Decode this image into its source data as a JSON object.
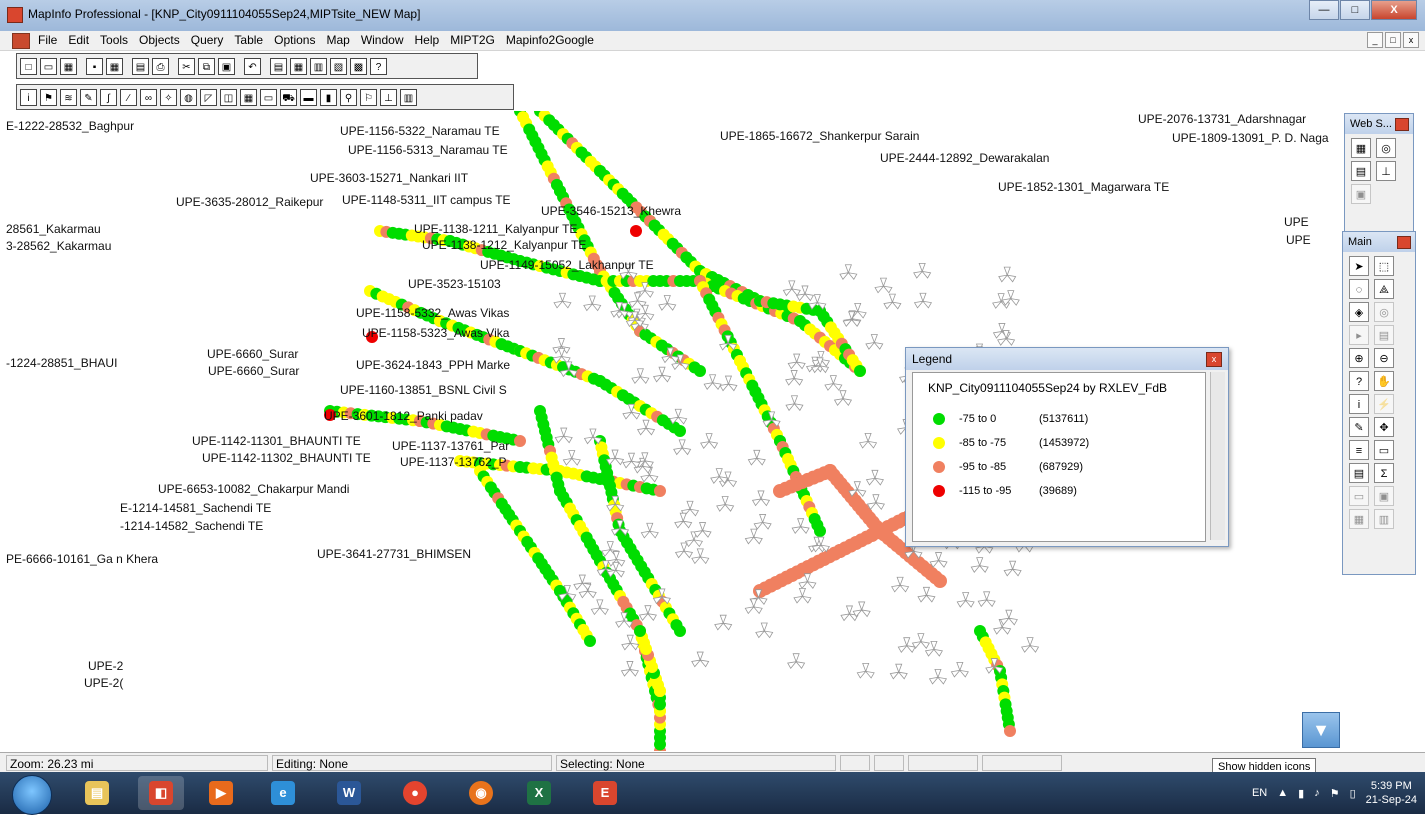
{
  "window": {
    "title": "MapInfo Professional - [KNP_City0911104055Sep24,MIPTsite_NEW Map]",
    "min": "—",
    "max": "□",
    "close": "X"
  },
  "menu": {
    "items": [
      "File",
      "Edit",
      "Tools",
      "Objects",
      "Query",
      "Table",
      "Options",
      "Map",
      "Window",
      "Help",
      "MIPT2G",
      "Mapinfo2Google"
    ],
    "mdi": [
      "_",
      "□",
      "x"
    ]
  },
  "map_labels": [
    {
      "text": "E-1222-28532_Baghpur"
    },
    {
      "text": "UPE-1156-5322_Naramau TE"
    },
    {
      "text": "UPE-1156-5313_Naramau TE"
    },
    {
      "text": "UPE-3603-15271_Nankari IIT"
    },
    {
      "text": "UPE-3635-28012_Raikepur"
    },
    {
      "text": "UPE-1148-5311_IIT campus TE"
    },
    {
      "text": "UPE-3546-15213_Khewra"
    },
    {
      "text": "28561_Kakarmau"
    },
    {
      "text": "3-28562_Kakarmau"
    },
    {
      "text": "UPE-1138-1211_Kalyanpur TE"
    },
    {
      "text": "UPE-1138-1212_Kalyanpur TE"
    },
    {
      "text": "UPE-1149-15052_Lakhanpur TE"
    },
    {
      "text": "UPE-3523-15103"
    },
    {
      "text": "UPE-1158-5332_Awas Vikas"
    },
    {
      "text": "UPE-1158-5323_Awas Vika"
    },
    {
      "text": "-1224-28851_BHAUI"
    },
    {
      "text": "UPE-6660_Surar"
    },
    {
      "text": "UPE-6660_Surar"
    },
    {
      "text": "UPE-3624-1843_PPH Marke"
    },
    {
      "text": "UPE-1160-13851_BSNL Civil S"
    },
    {
      "text": "UPE-3601-1812_Panki padav"
    },
    {
      "text": "UPE-1142-11301_BHAUNTI TE"
    },
    {
      "text": "UPE-1142-11302_BHAUNTI TE"
    },
    {
      "text": "UPE-1137-13761_Par"
    },
    {
      "text": "UPE-1137-13762_P"
    },
    {
      "text": "UPE-6653-10082_Chakarpur Mandi"
    },
    {
      "text": "E-1214-14581_Sachendi TE"
    },
    {
      "text": "-1214-14582_Sachendi TE"
    },
    {
      "text": "PE-6666-10161_Ga n Khera"
    },
    {
      "text": "UPE-3641-27731_BHIMSEN"
    },
    {
      "text": "UPE-1865-16672_Shankerpur Sarain"
    },
    {
      "text": "UPE-2444-12892_Dewarakalan"
    },
    {
      "text": "UPE-1852-1301_Magarwara TE"
    },
    {
      "text": "UPE-2076-13731_Adarshnagar"
    },
    {
      "text": "UPE-1809-13091_P. D. Naga"
    },
    {
      "text": "UPE"
    },
    {
      "text": "UPE"
    },
    {
      "text": "UPE-2"
    },
    {
      "text": "UPE-2("
    }
  ],
  "legend": {
    "window_title": "Legend",
    "heading": "KNP_City0911104055Sep24 by RXLEV_FdB",
    "rows": [
      {
        "range": "-75 to  0",
        "count": "(5137611)",
        "color": "#00dd00"
      },
      {
        "range": "-85 to -75",
        "count": "(1453972)",
        "color": "#ffff00"
      },
      {
        "range": "-95 to -85",
        "count": "(687929)",
        "color": "#f08060"
      },
      {
        "range": "-115 to -95",
        "count": "(39689)",
        "color": "#ee0000"
      }
    ]
  },
  "palettes": {
    "web": {
      "title": "Web S..."
    },
    "main": {
      "title": "Main"
    }
  },
  "status": {
    "zoom": "Zoom: 26.23 mi",
    "editing": "Editing: None",
    "selecting": "Selecting: None",
    "tooltip": "Show hidden icons"
  },
  "tray": {
    "lang": "EN",
    "time": "5:39 PM",
    "date": "21-Sep-24"
  },
  "colors": {
    "good": "#00dd00",
    "fair": "#ffff00",
    "weak": "#f08060",
    "bad": "#ee0000",
    "site": "#999999"
  }
}
